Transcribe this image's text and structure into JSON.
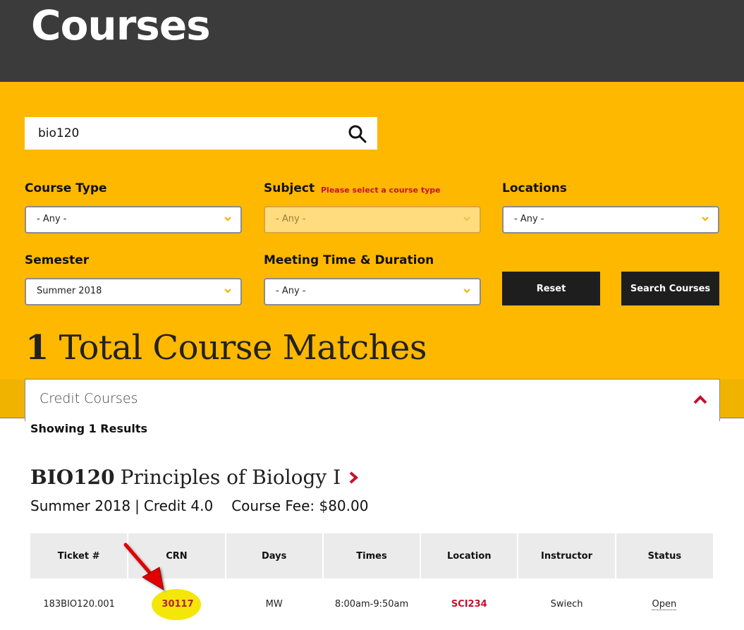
{
  "header": {
    "title": "Courses"
  },
  "search": {
    "value": "bio120",
    "placeholder": ""
  },
  "filters": {
    "course_type": {
      "label": "Course Type",
      "value": "- Any -"
    },
    "subject": {
      "label": "Subject",
      "warning": "Please select a course type",
      "value": "- Any -",
      "disabled": true
    },
    "locations": {
      "label": "Locations",
      "value": "- Any -"
    },
    "semester": {
      "label": "Semester",
      "value": "Summer 2018"
    },
    "meeting_time": {
      "label": "Meeting Time & Duration",
      "value": "- Any -"
    },
    "reset_label": "Reset",
    "search_label": "Search Courses"
  },
  "results": {
    "count": "1",
    "total_label": "Total Course Matches",
    "tab_label": "Credit Courses",
    "showing": "Showing 1 Results"
  },
  "course": {
    "code": "BIO120",
    "name": "Principles of Biology I",
    "semester": "Summer 2018",
    "separator": "|",
    "credit": "Credit 4.0",
    "fee": "Course Fee: $80.00",
    "columns": [
      "Ticket #",
      "CRN",
      "Days",
      "Times",
      "Location",
      "Instructor",
      "Status"
    ],
    "sections": [
      {
        "ticket": "183BIO120.001",
        "crn": "30117",
        "days": "MW",
        "times": "8:00am-9:50am",
        "location": "SCI234",
        "instructor": "Swiech",
        "status": "Open"
      }
    ]
  },
  "colors": {
    "header_bg": "#3b3b3b",
    "accent_yellow": "#ffb800",
    "accent_red": "#c8102e",
    "button_bg": "#1e1e1e",
    "highlight": "#f5e60a"
  }
}
